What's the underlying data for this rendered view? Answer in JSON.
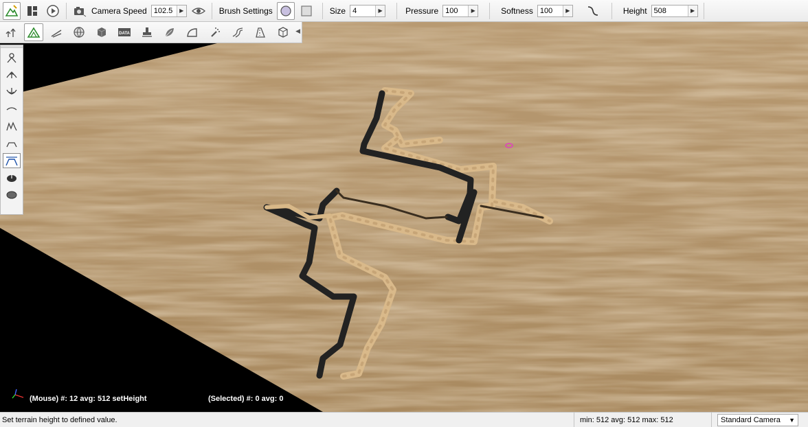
{
  "toolbar": {
    "camera_speed_label": "Camera Speed",
    "camera_speed_value": "102.5",
    "brush_settings_label": "Brush Settings",
    "size_label": "Size",
    "size_value": "4",
    "pressure_label": "Pressure",
    "pressure_value": "100",
    "softness_label": "Softness",
    "softness_value": "100",
    "height_label": "Height",
    "height_value": "508"
  },
  "toolbar2": {
    "icons": [
      "tree-icon",
      "terrain-icon",
      "road-icon",
      "globe-icon",
      "cube-icon",
      "data-icon",
      "stamp-icon",
      "leaf-icon",
      "slope-icon",
      "spray-icon",
      "river-icon",
      "path-icon",
      "mesh-icon"
    ],
    "data_badge": "DATA"
  },
  "sidebar": {
    "icons": [
      "raise-icon",
      "elevate-icon",
      "lower-icon",
      "smooth-icon",
      "noise-icon",
      "flatten-icon",
      "set-height-icon",
      "paint-icon",
      "erase-icon"
    ]
  },
  "viewport": {
    "mouse_info": "(Mouse) #: 12  avg: 512 setHeight",
    "selected_info": "(Selected) #: 0  avg: 0"
  },
  "statusbar": {
    "message": "Set terrain height to defined value.",
    "stats": "min: 512  avg: 512  max: 512",
    "camera": "Standard Camera"
  },
  "colors": {
    "terrain": "#b6956b",
    "cursor": "#e040c0"
  }
}
